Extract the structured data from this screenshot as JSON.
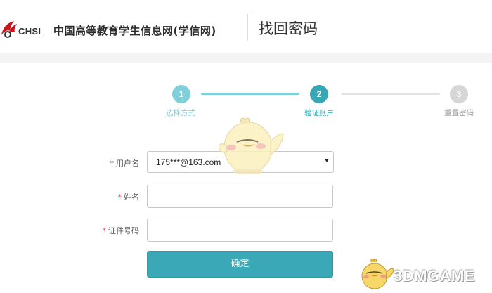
{
  "header": {
    "logo_text": "CHSI",
    "site_name": "中国高等教育学生信息网(学信网)",
    "page_title": "找回密码"
  },
  "steps": [
    {
      "number": "1",
      "label": "选择方式",
      "state": "done"
    },
    {
      "number": "2",
      "label": "验证账户",
      "state": "active"
    },
    {
      "number": "3",
      "label": "重置密码",
      "state": "pending"
    }
  ],
  "form": {
    "required_mark": "*",
    "username": {
      "label": "用户名",
      "value": "175***@163.com"
    },
    "name": {
      "label": "姓名",
      "value": ""
    },
    "id_number": {
      "label": "证件号码",
      "value": ""
    },
    "submit_label": "确定"
  },
  "watermark": {
    "text": "3DMGAME"
  },
  "colors": {
    "accent": "#3aa8b6",
    "step_done": "#7fd0da",
    "step_active": "#35a8b5",
    "step_pending": "#d6d6d6",
    "required": "#e84c3d"
  },
  "icons": {
    "logo": "chsi-bird-logo",
    "caret": "dropdown-caret-icon",
    "mascot": "chick-mascot-icon"
  }
}
